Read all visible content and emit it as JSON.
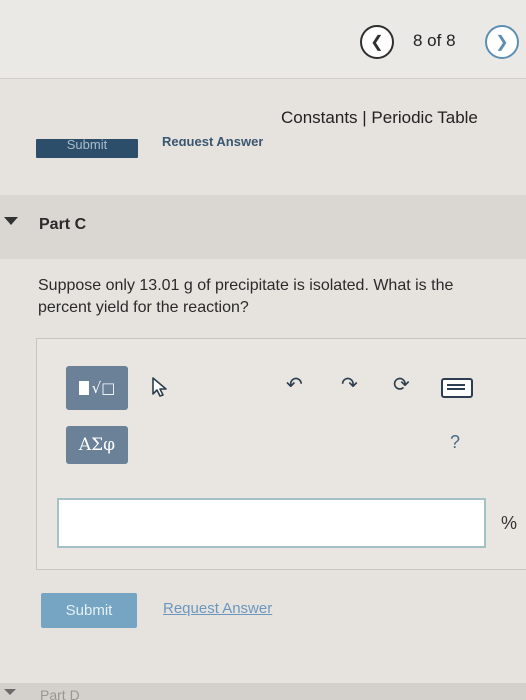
{
  "nav": {
    "prev_icon": "chevron-left",
    "page_indicator": "8 of 8",
    "next_icon": "chevron-right"
  },
  "reference": {
    "text": "Constants | Periodic Table"
  },
  "previous_part": {
    "submit_label": "Submit",
    "request_label": "Request Answer"
  },
  "part": {
    "title": "Part C"
  },
  "question": {
    "text": "Suppose only 13.01 g of precipitate is isolated. What is the percent yield for the reaction?"
  },
  "toolbar": {
    "template_label": "√□",
    "greek_label": "ΑΣφ",
    "help_label": "?"
  },
  "answer": {
    "value": "",
    "unit": "%"
  },
  "actions": {
    "submit_label": "Submit",
    "request_label": "Request Answer"
  },
  "next_part": {
    "title": "Part D"
  },
  "colors": {
    "submit_bg": "#75a5c2",
    "toolbar_bg": "#6b8197",
    "link": "#6c97bd"
  }
}
